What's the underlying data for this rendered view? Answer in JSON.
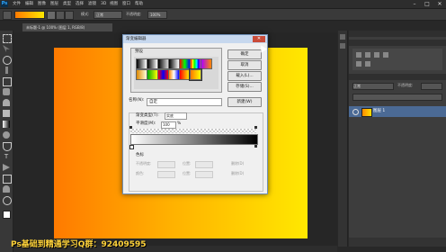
{
  "app": {
    "logo_text": "Ps"
  },
  "menubar": {
    "items": [
      "文件",
      "编辑",
      "图像",
      "图层",
      "类型",
      "选择",
      "滤镜",
      "3D",
      "视图",
      "窗口",
      "帮助"
    ]
  },
  "window_controls": {
    "minimize": "–",
    "maximize": "□",
    "close": "✕"
  },
  "options_bar": {
    "mode_label": "模式:",
    "mode_value": "正常",
    "opacity_label": "不透明度:",
    "opacity_value": "100%"
  },
  "document": {
    "tab_title": "未标题-1 @ 100% (图层 1, RGB/8)"
  },
  "dialog": {
    "title": "渐变编辑器",
    "presets_label": "预设",
    "buttons": [
      "确定",
      "取消",
      "载入(L)...",
      "存储(S)..."
    ],
    "name_label": "名称(N):",
    "name_value": "自定",
    "new_button": "新建(W)",
    "gradient_type_label": "渐变类型(T):",
    "gradient_type_value": "实底",
    "smoothness_label": "平滑度(M):",
    "smoothness_value": "100",
    "smoothness_unit": "%",
    "stops_label": "色标",
    "stop_fields": [
      "不透明度:",
      "位置:",
      "删除(D)",
      "颜色:",
      "位置:",
      "删除(D)"
    ]
  },
  "panels": {
    "blend_mode": "正常",
    "opacity_label": "不透明度:",
    "layer_name": "图层 1"
  },
  "watermark": {
    "text": "Ps基础到精通学习Q群：92409595"
  },
  "colors": {
    "gradient_start": "#ff7a00",
    "gradient_end": "#ffe800",
    "accent": "#4b6a95"
  }
}
